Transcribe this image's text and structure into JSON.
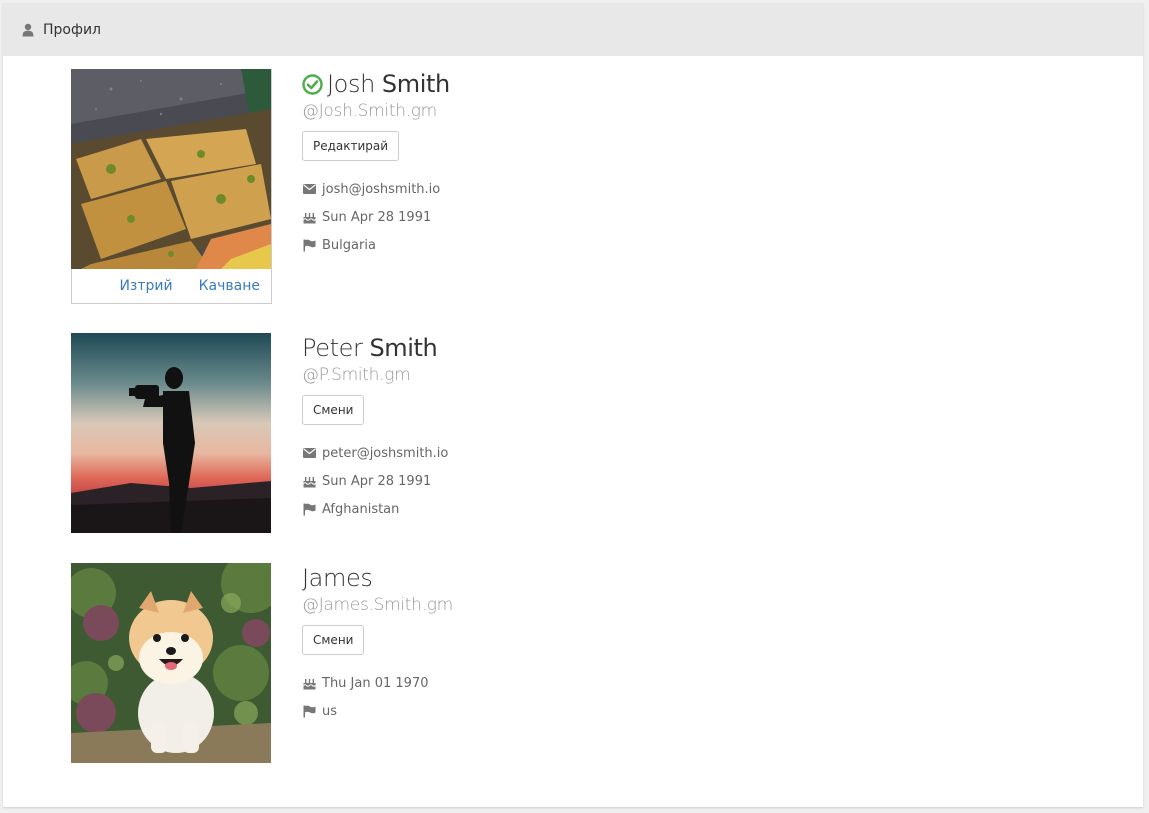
{
  "header": {
    "title": "Профил",
    "icon": "user-icon"
  },
  "profiles": [
    {
      "first_name": "Josh",
      "last_name": "Smith",
      "verified": true,
      "handle": "@Josh.Smith.gm",
      "button_label": "Редактирай",
      "photo_actions": {
        "delete_label": "Изтрий",
        "upload_label": "Качване"
      },
      "email": "josh@joshsmith.io",
      "birthday": "Sun Apr 28 1991",
      "country": "Bulgaria",
      "photo_subject": "baklava-pastry"
    },
    {
      "first_name": "Peter",
      "last_name": "Smith",
      "handle": "@P.Smith.gm",
      "button_label": "Смени",
      "email": "peter@joshsmith.io",
      "birthday": "Sun Apr 28 1991",
      "country": "Afghanistan",
      "photo_subject": "photographer-silhouette-sunset"
    },
    {
      "first_name": "James",
      "last_name": "",
      "handle": "@James.Smith.gm",
      "button_label": "Смени",
      "birthday": "Thu Jan 01 1970",
      "country": "us",
      "photo_subject": "pomeranian-dog"
    }
  ],
  "colors": {
    "verified": "#4cae4c",
    "link": "#3a7abf",
    "header_bg": "#e8e8e8"
  },
  "icons": {
    "email": "envelope-icon",
    "birthday": "birthday-cake-icon",
    "country": "flag-icon",
    "verified": "check-circle-icon"
  }
}
